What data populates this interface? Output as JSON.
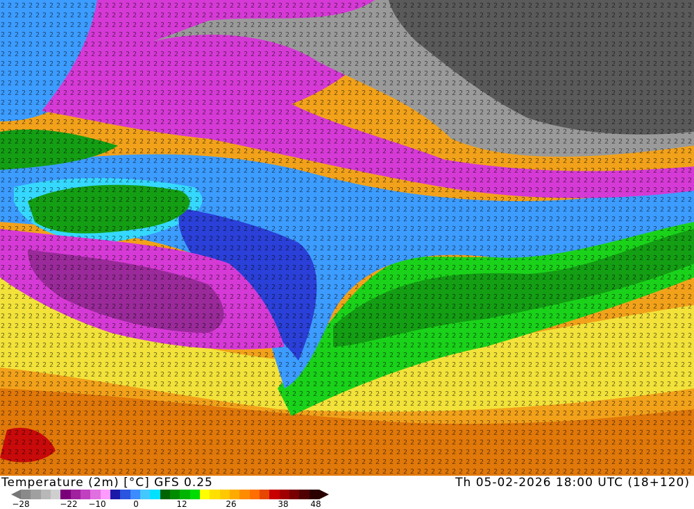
{
  "title": {
    "variable": "Temperature (2m) [°C] GFS 0.25",
    "datetime": "Th 05-02-2026 18:00 UTC (18+120)"
  },
  "legend": {
    "ticks": [
      "−28",
      "−22",
      "−10",
      "0",
      "12",
      "26",
      "38",
      "48"
    ],
    "colors": [
      "#8a8a8a",
      "#a0a0a0",
      "#b8b8b8",
      "#cfcfcf",
      "#7a007a",
      "#a020a0",
      "#c040c0",
      "#e070e0",
      "#ff9bff",
      "#1a1aa8",
      "#2b55e0",
      "#3c8cff",
      "#42c8ff",
      "#00e0ff",
      "#006400",
      "#008c00",
      "#00b400",
      "#00dc00",
      "#ffff00",
      "#ffe000",
      "#ffc800",
      "#ffaa00",
      "#ff8c00",
      "#ff6e00",
      "#e64600",
      "#c80000",
      "#a00000",
      "#780000",
      "#500000",
      "#2a0000"
    ]
  },
  "map": {
    "colors": {
      "very_cold": "#5a5a5a",
      "cold_grey": "#9a9a9a",
      "magenta": "#d63ad6",
      "violet": "#9a2a9a",
      "blue": "#2a40d8",
      "light_blue": "#3c9cff",
      "cyan": "#35d8ff",
      "green": "#149e14",
      "bright_green": "#1ad21a",
      "yellow": "#f2e23a",
      "orange": "#f2a21a",
      "dark_orange": "#e0780a",
      "red": "#c80a0a"
    }
  }
}
